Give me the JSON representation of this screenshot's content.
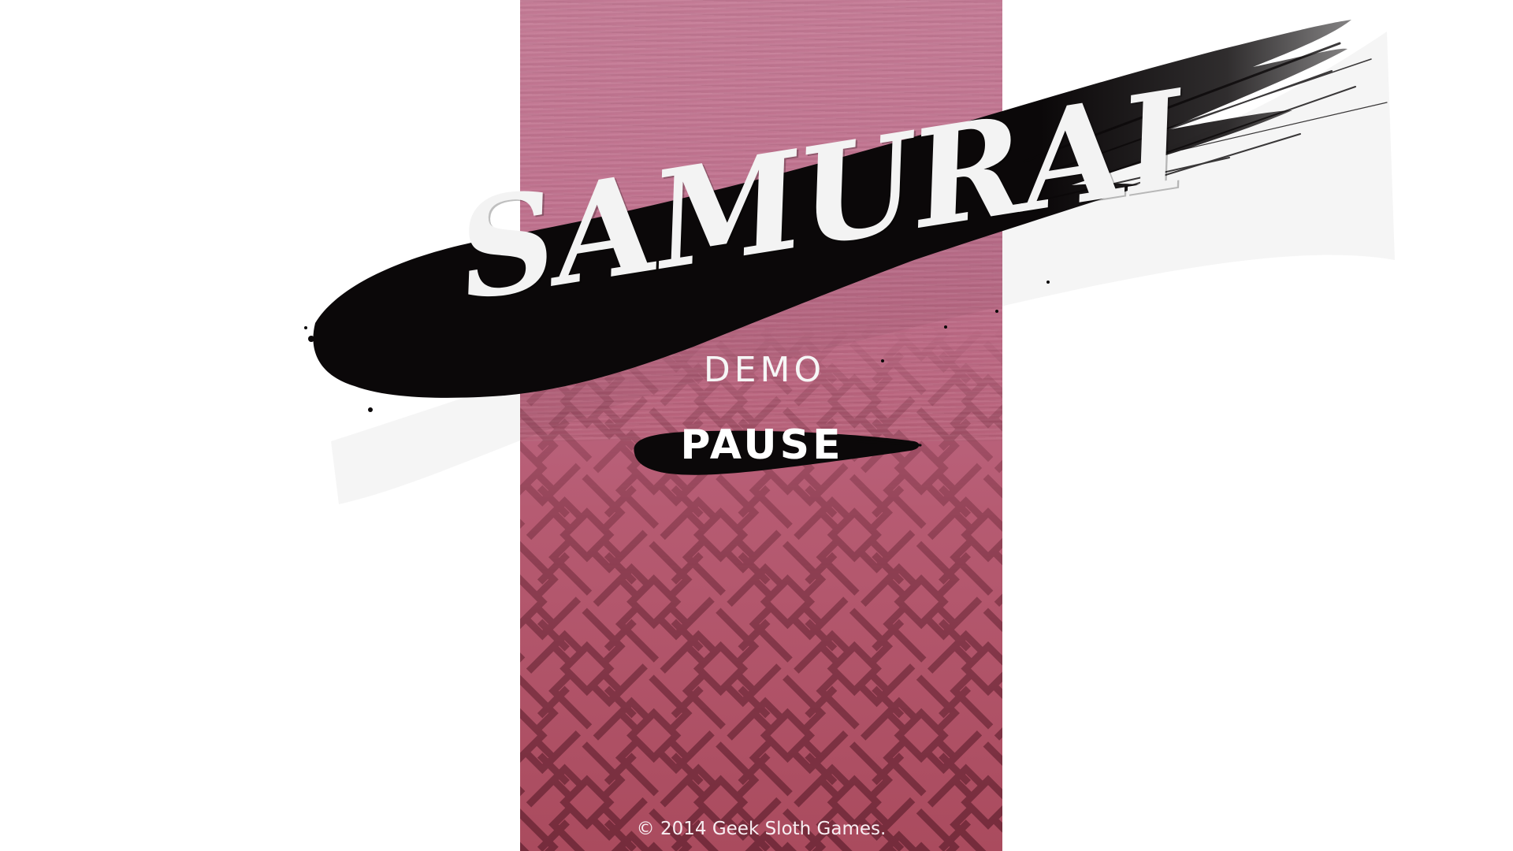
{
  "game": {
    "logo_title": "SAMURAI",
    "subtitle": "DEMO",
    "menu": {
      "pause_label": "PAUSE"
    },
    "footer": {
      "copyright": "© 2014 Geek Sloth Games."
    }
  },
  "colors": {
    "panel_top": "#c47a95",
    "panel_bottom": "#aa4b5e",
    "pattern_line": "#5c1c2a",
    "ink": "#0b0809",
    "text": "#ffffff"
  }
}
